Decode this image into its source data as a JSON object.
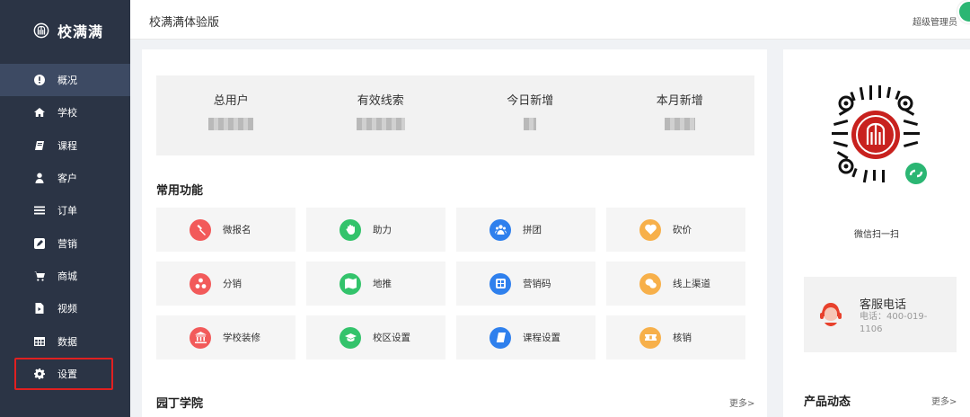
{
  "brand": {
    "name": "校满满"
  },
  "sidebar": {
    "items": [
      {
        "label": "概况",
        "icon": "alert-circle-icon"
      },
      {
        "label": "学校",
        "icon": "home-icon"
      },
      {
        "label": "课程",
        "icon": "book-icon"
      },
      {
        "label": "客户",
        "icon": "user-icon"
      },
      {
        "label": "订单",
        "icon": "list-icon"
      },
      {
        "label": "营销",
        "icon": "edit-icon"
      },
      {
        "label": "商城",
        "icon": "cart-icon"
      },
      {
        "label": "视频",
        "icon": "video-file-icon"
      },
      {
        "label": "数据",
        "icon": "table-icon"
      },
      {
        "label": "设置",
        "icon": "gear-icon"
      }
    ],
    "active_index": 0
  },
  "header": {
    "title": "校满满体验版",
    "user": "超级管理员"
  },
  "stats": [
    {
      "label": "总用户"
    },
    {
      "label": "有效线索"
    },
    {
      "label": "今日新增"
    },
    {
      "label": "本月新增"
    }
  ],
  "common": {
    "title": "常用功能",
    "items": [
      {
        "label": "微报名",
        "color": "#f25a5a",
        "icon": "hammer-icon"
      },
      {
        "label": "助力",
        "color": "#33c36b",
        "icon": "hand-icon"
      },
      {
        "label": "拼团",
        "color": "#2f80ed",
        "icon": "group-icon"
      },
      {
        "label": "砍价",
        "color": "#f7b04a",
        "icon": "heart-icon"
      },
      {
        "label": "分销",
        "color": "#f25a5a",
        "icon": "share-icon"
      },
      {
        "label": "地推",
        "color": "#33c36b",
        "icon": "map-icon"
      },
      {
        "label": "营销码",
        "color": "#2f80ed",
        "icon": "qrcode-icon"
      },
      {
        "label": "线上渠道",
        "color": "#f7b04a",
        "icon": "wechat-icon"
      },
      {
        "label": "学校装修",
        "color": "#f25a5a",
        "icon": "bank-icon"
      },
      {
        "label": "校区设置",
        "color": "#33c36b",
        "icon": "graduation-cap-icon"
      },
      {
        "label": "课程设置",
        "color": "#2f80ed",
        "icon": "book-icon"
      },
      {
        "label": "核销",
        "color": "#f7b04a",
        "icon": "ticket-icon"
      }
    ]
  },
  "academy": {
    "title": "园丁学院",
    "more": "更多>"
  },
  "right": {
    "qr_caption": "微信扫一扫",
    "service_name": "客服电话",
    "service_phone": "电话：400-019-1106",
    "news_title": "产品动态",
    "news_more": "更多>"
  }
}
